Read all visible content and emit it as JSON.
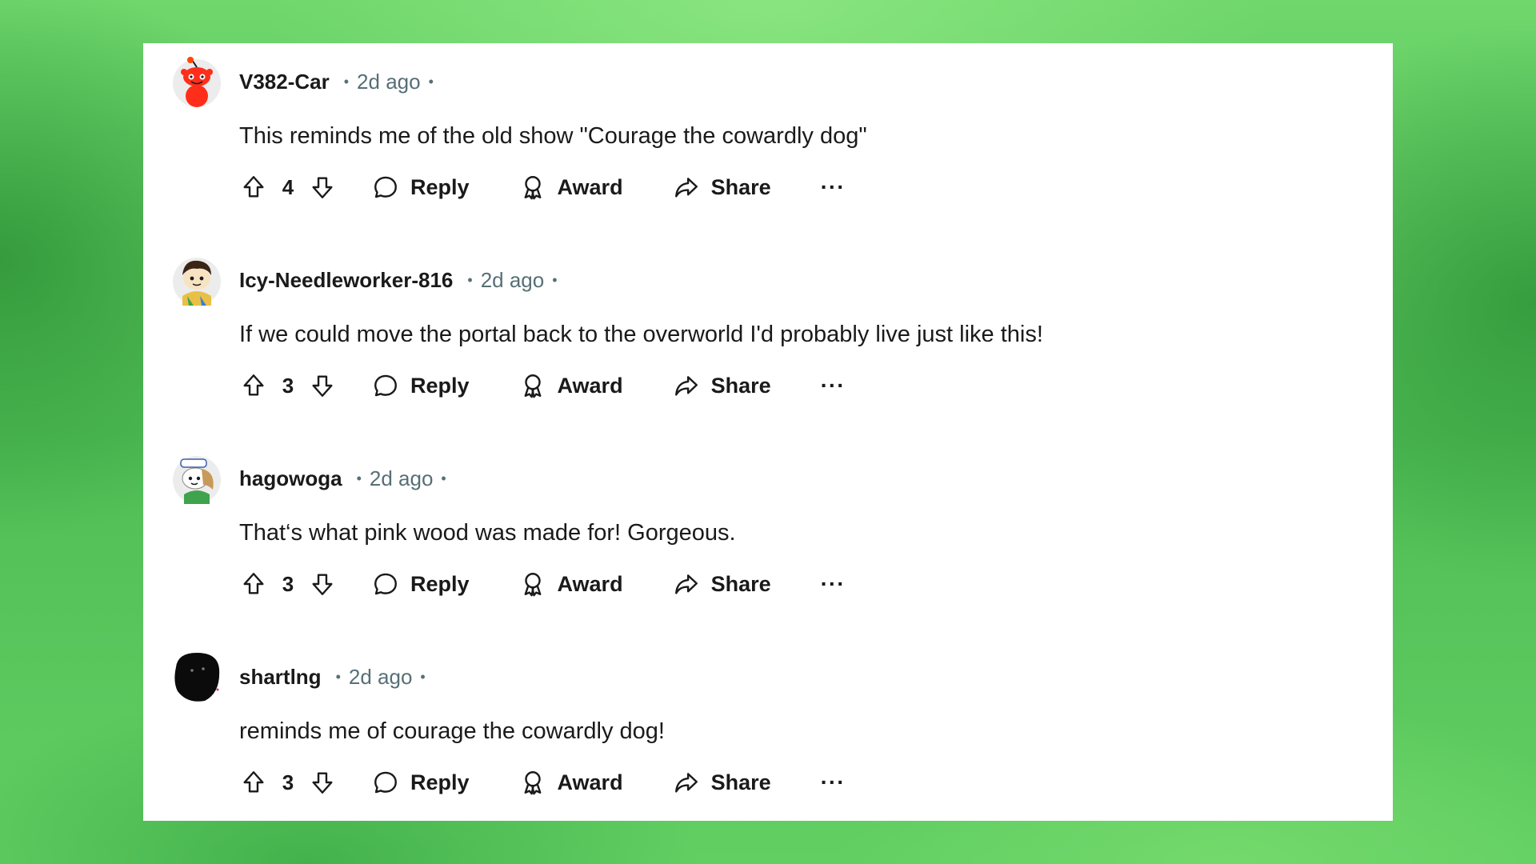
{
  "colors": {
    "background": "#5ccb5f",
    "card": "#ffffff",
    "text": "#1a1a1b",
    "meta_text": "#576f76"
  },
  "actions": {
    "reply_label": "Reply",
    "award_label": "Award",
    "share_label": "Share",
    "more_label": "···",
    "upvote_icon": "upvote-arrow-icon",
    "downvote_icon": "downvote-arrow-icon",
    "reply_icon": "speech-bubble-icon",
    "award_icon": "award-ribbon-icon",
    "share_icon": "share-arrow-icon"
  },
  "comments": [
    {
      "username": "V382-Car",
      "separator": "•",
      "time": "2d ago",
      "body": "This reminds me of the old show \"Courage the cowardly dog\"",
      "score": "4",
      "avatar": "red-snoo-avatar"
    },
    {
      "username": "Icy-Needleworker-816",
      "separator": "•",
      "time": "2d ago",
      "body": "If we could move the portal back to the overworld I'd probably live just like this!",
      "score": "3",
      "avatar": "dark-hair-snoo-avatar"
    },
    {
      "username": "hagowoga",
      "separator": "•",
      "time": "2d ago",
      "body": "That‘s what pink wood was made for! Gorgeous.",
      "score": "3",
      "avatar": "hat-snoo-avatar"
    },
    {
      "username": "shartlng",
      "separator": "•",
      "time": "2d ago",
      "body": "reminds me of courage the cowardly dog!",
      "score": "3",
      "avatar": "black-blob-avatar"
    }
  ]
}
